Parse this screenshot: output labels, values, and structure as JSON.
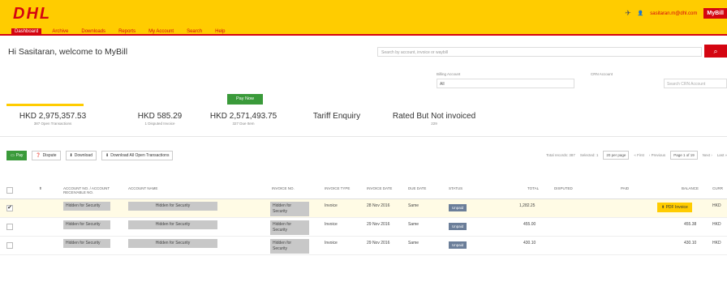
{
  "brand": {
    "logo": "DHL"
  },
  "header": {
    "user_email": "sasitaran.m@dhl.com",
    "mybill_label": "MyBill"
  },
  "nav": {
    "items": [
      "Dashboard",
      "Archive",
      "Downloads",
      "Reports",
      "My Account",
      "Search",
      "Help"
    ]
  },
  "welcome": "Hi Sasitaran, welcome to MyBill",
  "search": {
    "placeholder": "Search by account, invoice or waybill"
  },
  "filters": {
    "billing_label": "Billing Account",
    "billing_value": "All",
    "crn_label": "CRN Account",
    "crn_placeholder": "Search CRN Account"
  },
  "pay_now_label": "Pay Now",
  "summary": [
    {
      "amount": "HKD 2,975,357.53",
      "sub": "387 Open Transactions"
    },
    {
      "amount": "HKD 585.29",
      "sub": "1 Disputed Invoice"
    },
    {
      "amount": "HKD 2,571,493.75",
      "sub": "327 Due Item"
    },
    {
      "amount": "Tariff Enquiry",
      "sub": ""
    },
    {
      "amount": "Rated But Not invoiced",
      "sub": "229"
    }
  ],
  "toolbar": {
    "pay": "Pay",
    "dispute": "Dispute",
    "download": "Download",
    "download_all": "Download All Open Transactions"
  },
  "pager": {
    "total": "Total records: 387",
    "selected": "Selected: 1",
    "per_page": "20 per page",
    "first": "« First",
    "previous": "‹ Previous",
    "page": "Page 1 of 19",
    "next": "Next ›",
    "last": "Last »"
  },
  "table": {
    "headers": [
      "Account No. / Account Receivable No.",
      "Account Name",
      "Invoice No.",
      "Invoice Type",
      "Invoice Date",
      "Due Date",
      "Status",
      "Total",
      "Disputed",
      "Paid",
      "Balance",
      "Curr"
    ],
    "rows": [
      {
        "account": "Hidden for Security",
        "name": "Hidden for Security",
        "invoice": "Hidden for Security",
        "type": "Invoice",
        "date": "28 Nov 2016",
        "due": "Same",
        "status": "Unpaid",
        "total": "1,282.25",
        "pdf": "PDF Invoice",
        "balance": "",
        "curr": "HKD",
        "selected": true
      },
      {
        "account": "Hidden for Security",
        "name": "Hidden for Security",
        "invoice": "Hidden for Security",
        "type": "Invoice",
        "date": "29 Nov 2016",
        "due": "Same",
        "status": "Unpaid",
        "total": "455.00",
        "pdf": "",
        "balance": "455.38",
        "curr": "HKD",
        "selected": false
      },
      {
        "account": "Hidden for Security",
        "name": "Hidden for Security",
        "invoice": "Hidden for Security",
        "type": "Invoice",
        "date": "29 Nov 2016",
        "due": "Same",
        "status": "Unpaid",
        "total": "430.10",
        "pdf": "",
        "balance": "430.10",
        "curr": "HKD",
        "selected": false
      }
    ]
  }
}
